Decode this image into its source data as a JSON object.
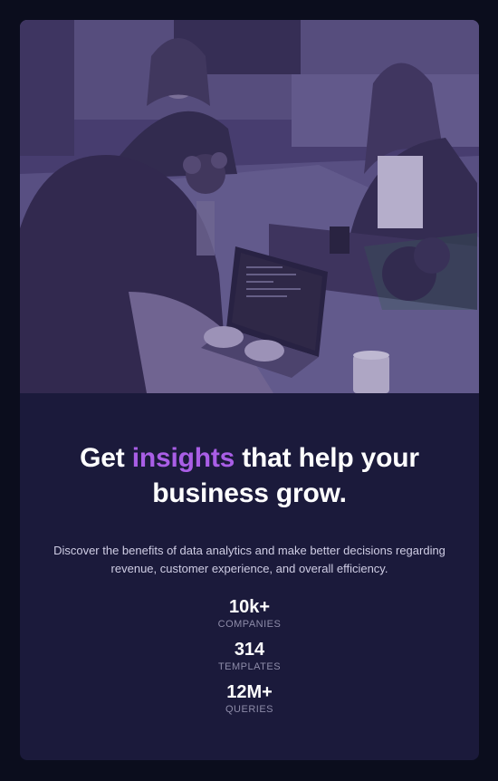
{
  "hero": {
    "image_alt": "Three women working together at a table with laptops"
  },
  "headline": {
    "before": "Get ",
    "accent": "insights",
    "after": " that help your business grow."
  },
  "description": "Discover the benefits of data analytics and make better decisions regarding revenue, customer experience, and overall efficiency.",
  "stats": [
    {
      "value": "10k+",
      "label": "companies"
    },
    {
      "value": "314",
      "label": "templates"
    },
    {
      "value": "12M+",
      "label": "queries"
    }
  ],
  "colors": {
    "page_bg": "#0b0d1d",
    "card_bg": "#1b1a3b",
    "accent": "#a95ee6",
    "image_tint": "#4a4070",
    "muted_label": "#8e8ca9"
  }
}
